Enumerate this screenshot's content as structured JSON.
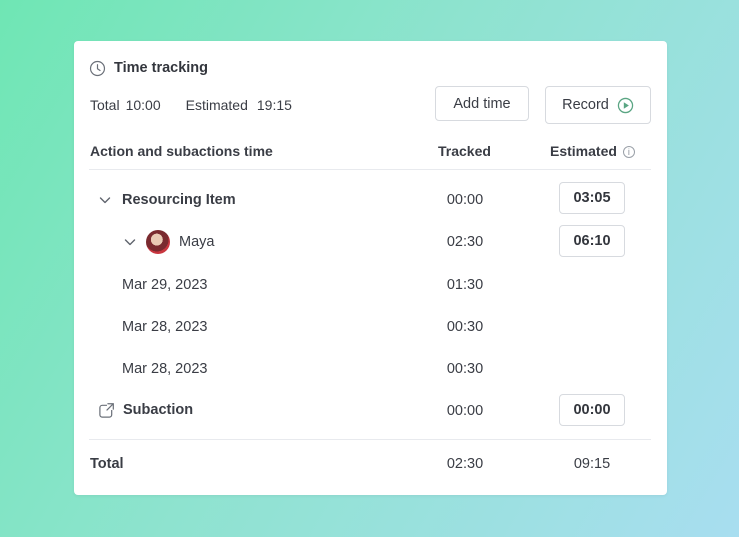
{
  "header": {
    "title": "Time tracking",
    "icon": "clock-icon"
  },
  "summary": {
    "total_label": "Total",
    "total_value": "10:00",
    "estimated_label": "Estimated",
    "estimated_value": "19:15"
  },
  "buttons": {
    "add_time": "Add time",
    "record": "Record"
  },
  "table": {
    "columns": {
      "action": "Action and subactions time",
      "tracked": "Tracked",
      "estimated": "Estimated"
    },
    "rows": [
      {
        "label": "Resourcing Item",
        "tracked": "00:00",
        "estimated": "03:05"
      },
      {
        "label": "Maya",
        "tracked": "02:30",
        "estimated": "06:10"
      },
      {
        "label": "Mar 29, 2023",
        "tracked": "01:30",
        "estimated": ""
      },
      {
        "label": "Mar 28, 2023",
        "tracked": "00:30",
        "estimated": ""
      },
      {
        "label": "Mar 28, 2023",
        "tracked": "00:30",
        "estimated": ""
      },
      {
        "label": "Subaction",
        "tracked": "00:00",
        "estimated": "00:00"
      }
    ],
    "total": {
      "label": "Total",
      "tracked": "02:30",
      "estimated": "09:15"
    }
  },
  "colors": {
    "accent_green": "#5aa583",
    "background_start": "#6fe6b4",
    "background_end": "#a8def0"
  }
}
